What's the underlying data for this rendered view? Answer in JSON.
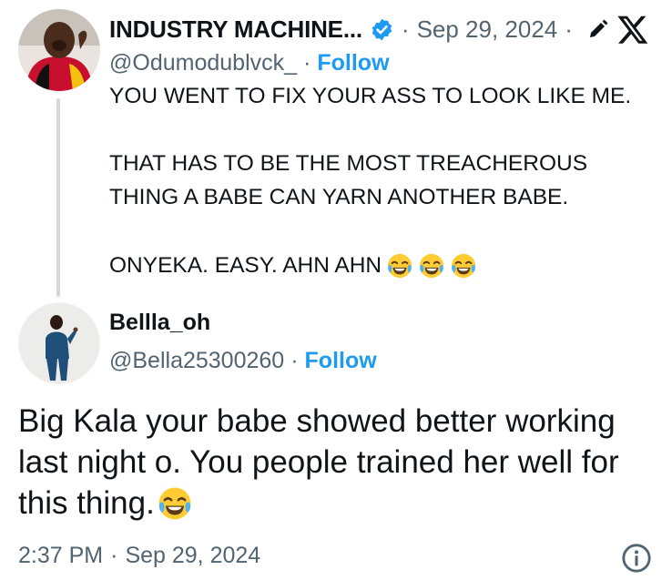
{
  "parent_tweet": {
    "display_name": "INDUSTRY MACHINE...",
    "verified_icon": "verified-badge-icon",
    "separator": "·",
    "date": "Sep 29, 2024",
    "handle": "@Odumodublvck_",
    "follow_label": "Follow",
    "lines": [
      "YOU WENT TO FIX YOUR ASS TO LOOK LIKE ME.",
      "THAT HAS TO BE THE MOST TREACHEROUS",
      "THING A BABE CAN YARN ANOTHER BABE.",
      "ONYEKA. EASY. AHN AHN"
    ],
    "emoji": "face-with-tears-of-joy-icon",
    "emoji_count": 3
  },
  "reply_tweet": {
    "display_name": "Bellla_oh",
    "handle": "@Bella25300260",
    "separator": "·",
    "follow_label": "Follow",
    "lines": [
      "Big Kala your babe showed better working",
      "last night o. You people trained her well for",
      "this thing."
    ],
    "time": "2:37 PM",
    "separator2": "·",
    "date": "Sep 29, 2024"
  },
  "icons": {
    "brand": "x-logo-icon",
    "edit": "edit-pencil-icon",
    "info": "info-icon"
  },
  "colors": {
    "text": "#0f1419",
    "secondary": "#536471",
    "link": "#1d9bf0",
    "thread_line": "#cfd9de"
  }
}
